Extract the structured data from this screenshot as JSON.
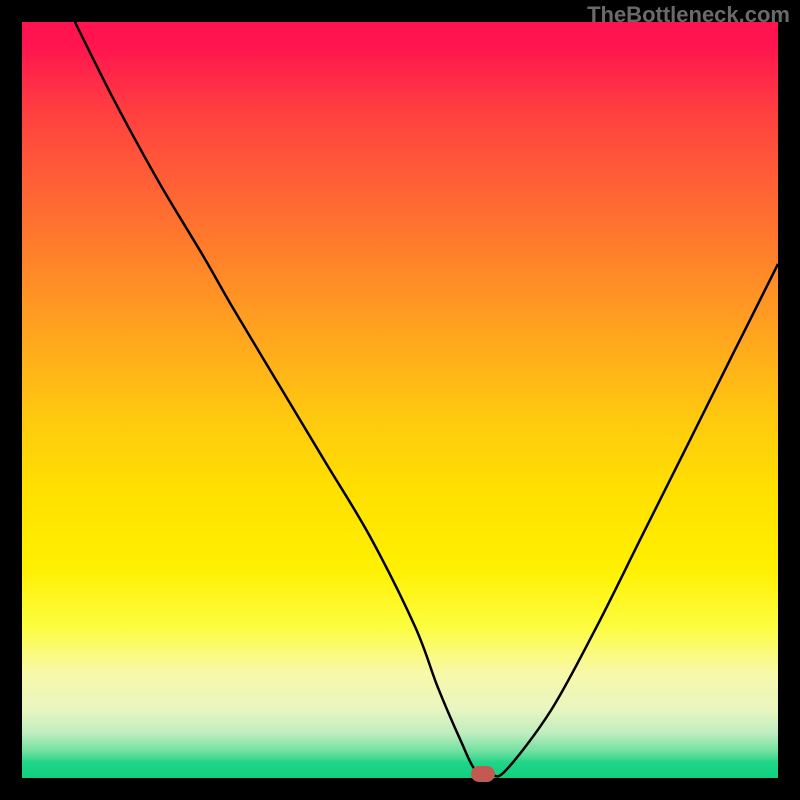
{
  "watermark": "TheBottleneck.com",
  "chart_data": {
    "type": "line",
    "title": "",
    "xlabel": "",
    "ylabel": "",
    "xlim": [
      0,
      100
    ],
    "ylim": [
      0,
      100
    ],
    "grid": false,
    "series": [
      {
        "name": "curve",
        "x": [
          7,
          12,
          18,
          24,
          28,
          34,
          40,
          46,
          52,
          55,
          58,
          60,
          62,
          64,
          70,
          76,
          82,
          88,
          94,
          100
        ],
        "y": [
          100,
          90,
          79,
          69,
          62,
          52,
          42,
          32,
          20,
          12,
          5,
          1,
          0.5,
          1,
          9,
          20,
          32,
          44,
          56,
          68
        ]
      }
    ],
    "marker": {
      "x": 61,
      "y": 0.5
    },
    "background_gradient": {
      "top_color": "#ff1450",
      "mid_color": "#ffe000",
      "bottom_color": "#10d080"
    }
  }
}
